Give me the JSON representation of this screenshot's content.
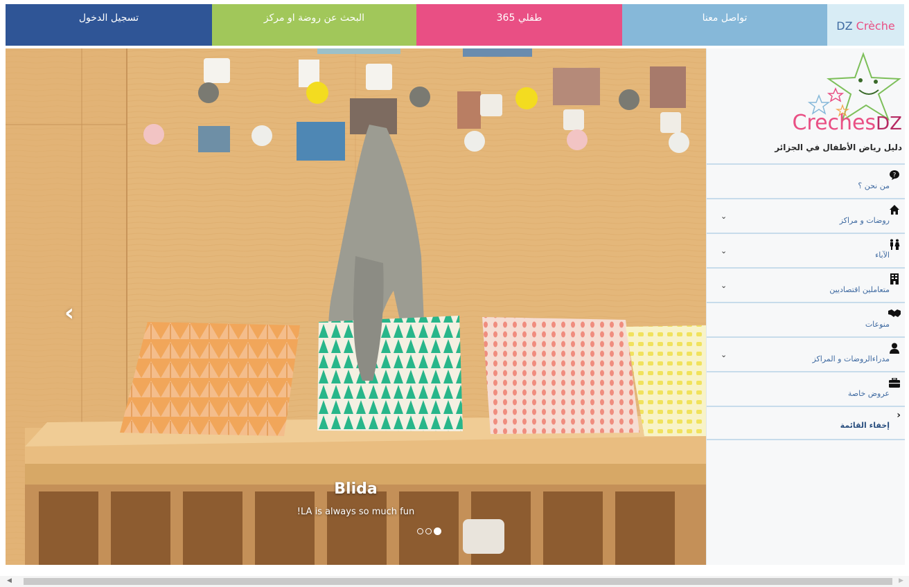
{
  "topnav": {
    "login": "تسجيل الدخول",
    "search": "البحث عن روضة او مركز",
    "child365": "طفلي 365",
    "contact": "تواصل معنا",
    "brand_part1": "DZ ",
    "brand_part2": "Crèche"
  },
  "slider": {
    "prev_icon": "‹",
    "caption_title": "Blida",
    "caption_text": "!LA is always so much fun",
    "slide_count": 3,
    "active_slide": 3
  },
  "sidebar": {
    "logo_part1": "Creches",
    "logo_part2": "DZ",
    "logo_subtitle": "دليل رياض الأطفال في الجزائر",
    "menu": [
      {
        "label": "من نحن ؟",
        "icon": "question-bubble-icon",
        "has_dropdown": false
      },
      {
        "label": "روضات و مراكز",
        "icon": "home-icon",
        "has_dropdown": true
      },
      {
        "label": "الآباء",
        "icon": "parents-icon",
        "has_dropdown": true
      },
      {
        "label": "متعاملين اقتصاديين",
        "icon": "building-icon",
        "has_dropdown": true
      },
      {
        "label": "منوعات",
        "icon": "handshake-icon",
        "has_dropdown": false
      },
      {
        "label": "مدراءالروضات و المراكز",
        "icon": "user-icon",
        "has_dropdown": true
      },
      {
        "label": "عروض خاصة",
        "icon": "briefcase-icon",
        "has_dropdown": false
      }
    ],
    "hide_menu_label": "إخفاء القائمة"
  },
  "colors": {
    "login_bg": "#2f5596",
    "search_bg": "#a1c75a",
    "child_bg": "#e94f84",
    "contact_bg": "#86b8d9",
    "brand_bg": "#d8ecf5"
  }
}
